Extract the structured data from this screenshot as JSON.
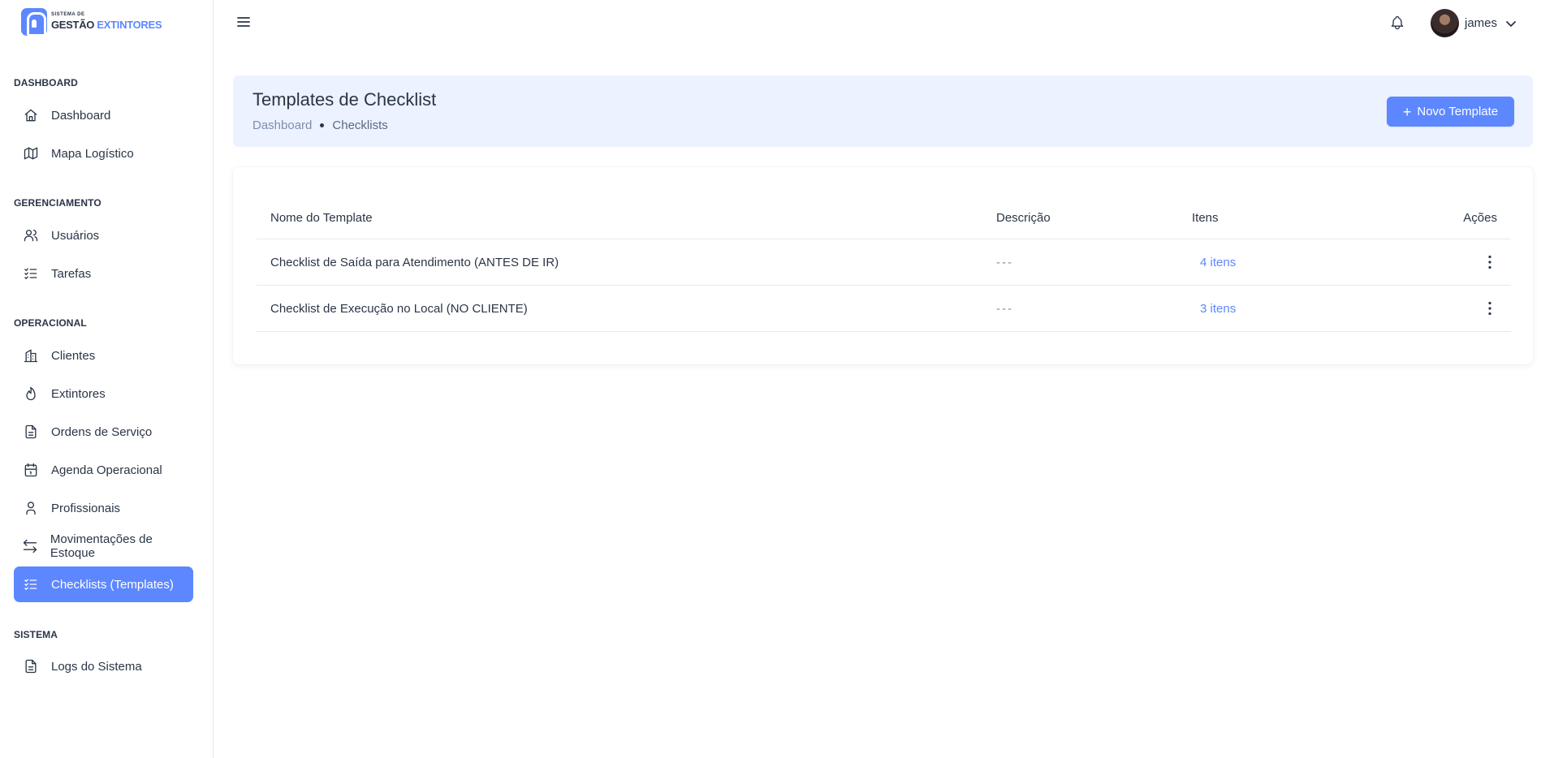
{
  "brand": {
    "sub": "SISTEMA DE",
    "main": "GESTÃO",
    "accent": "EXTINTORES",
    "color": "#5d87ff"
  },
  "sidebar": {
    "sections": [
      {
        "title": "DASHBOARD"
      },
      {
        "title": "GERENCIAMENTO"
      },
      {
        "title": "OPERACIONAL"
      },
      {
        "title": "SISTEMA"
      }
    ],
    "items": [
      {
        "label": "Dashboard",
        "icon": "home-icon"
      },
      {
        "label": "Mapa Logístico",
        "icon": "map-icon"
      },
      {
        "label": "Usuários",
        "icon": "users-icon"
      },
      {
        "label": "Tarefas",
        "icon": "list-check-icon"
      },
      {
        "label": "Clientes",
        "icon": "building-icon"
      },
      {
        "label": "Extintores",
        "icon": "flame-icon"
      },
      {
        "label": "Ordens de Serviço",
        "icon": "file-text-icon"
      },
      {
        "label": "Agenda Operacional",
        "icon": "calendar-icon"
      },
      {
        "label": "Profissionais",
        "icon": "user-icon"
      },
      {
        "label": "Movimentações de Estoque",
        "icon": "arrows-exchange-icon"
      },
      {
        "label": "Checklists (Templates)",
        "icon": "list-check-icon",
        "active": true
      },
      {
        "label": "Logs do Sistema",
        "icon": "file-text-icon"
      }
    ]
  },
  "header": {
    "user_name": "james",
    "icons": [
      "menu-icon",
      "bell-icon",
      "chevron-down-icon"
    ]
  },
  "page": {
    "title": "Templates de Checklist",
    "breadcrumb": [
      "Dashboard",
      "Checklists"
    ],
    "new_button": "Novo Template"
  },
  "table": {
    "columns": [
      "Nome do Template",
      "Descrição",
      "Itens",
      "Ações"
    ],
    "rows": [
      {
        "name": "Checklist de Saída para Atendimento (ANTES DE IR)",
        "description": "---",
        "items": "4 itens"
      },
      {
        "name": "Checklist de Execução no Local (NO CLIENTE)",
        "description": "---",
        "items": "3 itens"
      }
    ]
  }
}
